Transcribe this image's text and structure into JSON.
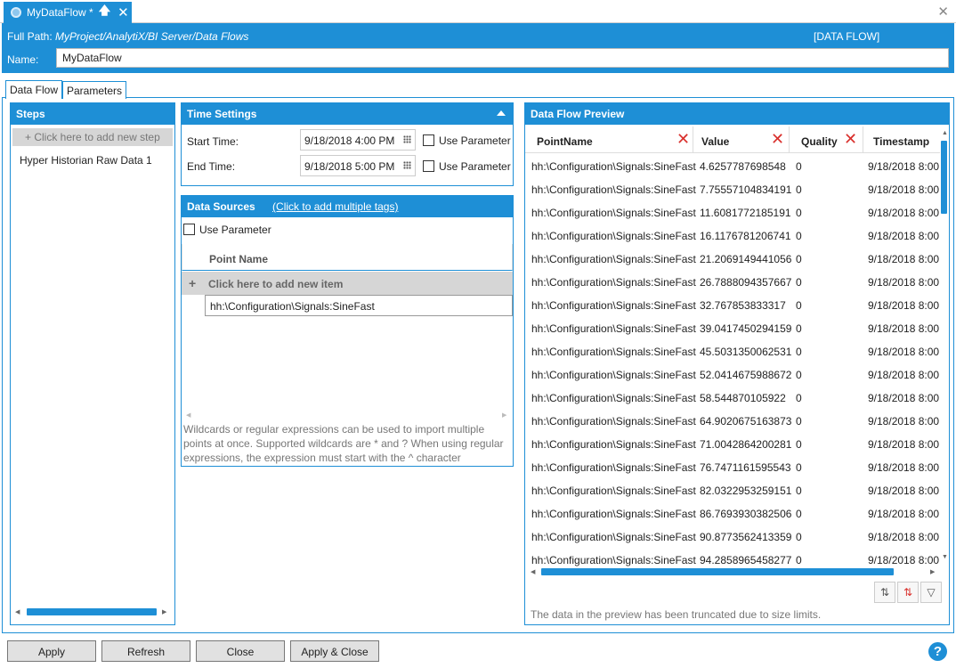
{
  "tab": {
    "title": "MyDataFlow *"
  },
  "header": {
    "full_path_label": "Full Path:",
    "full_path": "MyProject/AnalytiX/BI Server/Data Flows",
    "type_label": "[DATA FLOW]",
    "name_label": "Name:",
    "name_value": "MyDataFlow"
  },
  "subtabs": [
    "Data Flow",
    "Parameters"
  ],
  "steps": {
    "title": "Steps",
    "add_label": "+  Click here to add new step",
    "items": [
      "Hyper Historian Raw Data  1"
    ]
  },
  "time_settings": {
    "title": "Time Settings",
    "start_label": "Start Time:",
    "start_value": "9/18/2018 4:00 PM",
    "end_label": "End Time:",
    "end_value": "9/18/2018 5:00 PM",
    "use_param_label": "Use Parameter"
  },
  "data_sources": {
    "title": "Data Sources",
    "link": "(Click to add multiple tags)",
    "use_param_label": "Use Parameter",
    "column": "Point Name",
    "add_label": "Click here to add new item",
    "items": [
      "hh:\\Configuration\\Signals:SineFast"
    ],
    "help": "Wildcards or regular expressions can be used to import multiple points at once. Supported wildcards are * and ? When using regular expressions, the expression must start with the ^ character"
  },
  "preview": {
    "title": "Data Flow Preview",
    "columns": [
      "PointName",
      "Value",
      "Quality",
      "Timestamp"
    ],
    "rows": [
      [
        "hh:\\Configuration\\Signals:SineFast",
        "4.6257787698548",
        "0",
        "9/18/2018 8:00"
      ],
      [
        "hh:\\Configuration\\Signals:SineFast",
        "7.75557104834191",
        "0",
        "9/18/2018 8:00"
      ],
      [
        "hh:\\Configuration\\Signals:SineFast",
        "11.6081772185191",
        "0",
        "9/18/2018 8:00"
      ],
      [
        "hh:\\Configuration\\Signals:SineFast",
        "16.1176781206741",
        "0",
        "9/18/2018 8:00"
      ],
      [
        "hh:\\Configuration\\Signals:SineFast",
        "21.2069149441056",
        "0",
        "9/18/2018 8:00"
      ],
      [
        "hh:\\Configuration\\Signals:SineFast",
        "26.7888094357667",
        "0",
        "9/18/2018 8:00"
      ],
      [
        "hh:\\Configuration\\Signals:SineFast",
        "32.767853833317",
        "0",
        "9/18/2018 8:00"
      ],
      [
        "hh:\\Configuration\\Signals:SineFast",
        "39.0417450294159",
        "0",
        "9/18/2018 8:00"
      ],
      [
        "hh:\\Configuration\\Signals:SineFast",
        "45.5031350062531",
        "0",
        "9/18/2018 8:00"
      ],
      [
        "hh:\\Configuration\\Signals:SineFast",
        "52.0414675988672",
        "0",
        "9/18/2018 8:00"
      ],
      [
        "hh:\\Configuration\\Signals:SineFast",
        "58.544870105922",
        "0",
        "9/18/2018 8:00"
      ],
      [
        "hh:\\Configuration\\Signals:SineFast",
        "64.9020675163873",
        "0",
        "9/18/2018 8:00"
      ],
      [
        "hh:\\Configuration\\Signals:SineFast",
        "71.0042864200281",
        "0",
        "9/18/2018 8:00"
      ],
      [
        "hh:\\Configuration\\Signals:SineFast",
        "76.7471161595543",
        "0",
        "9/18/2018 8:00"
      ],
      [
        "hh:\\Configuration\\Signals:SineFast",
        "82.0322953259151",
        "0",
        "9/18/2018 8:00"
      ],
      [
        "hh:\\Configuration\\Signals:SineFast",
        "86.7693930382506",
        "0",
        "9/18/2018 8:00"
      ],
      [
        "hh:\\Configuration\\Signals:SineFast",
        "90.8773562413359",
        "0",
        "9/18/2018 8:00"
      ],
      [
        "hh:\\Configuration\\Signals:SineFast",
        "94.2858965458277",
        "0",
        "9/18/2018 8:00"
      ]
    ],
    "truncated_note": "The data in the preview has been truncated due to size limits."
  },
  "footer": {
    "apply": "Apply",
    "refresh": "Refresh",
    "close": "Close",
    "apply_close": "Apply & Close",
    "help": "?"
  },
  "colors": {
    "accent": "#1e8fd6",
    "filter_x": "#d9302c"
  }
}
